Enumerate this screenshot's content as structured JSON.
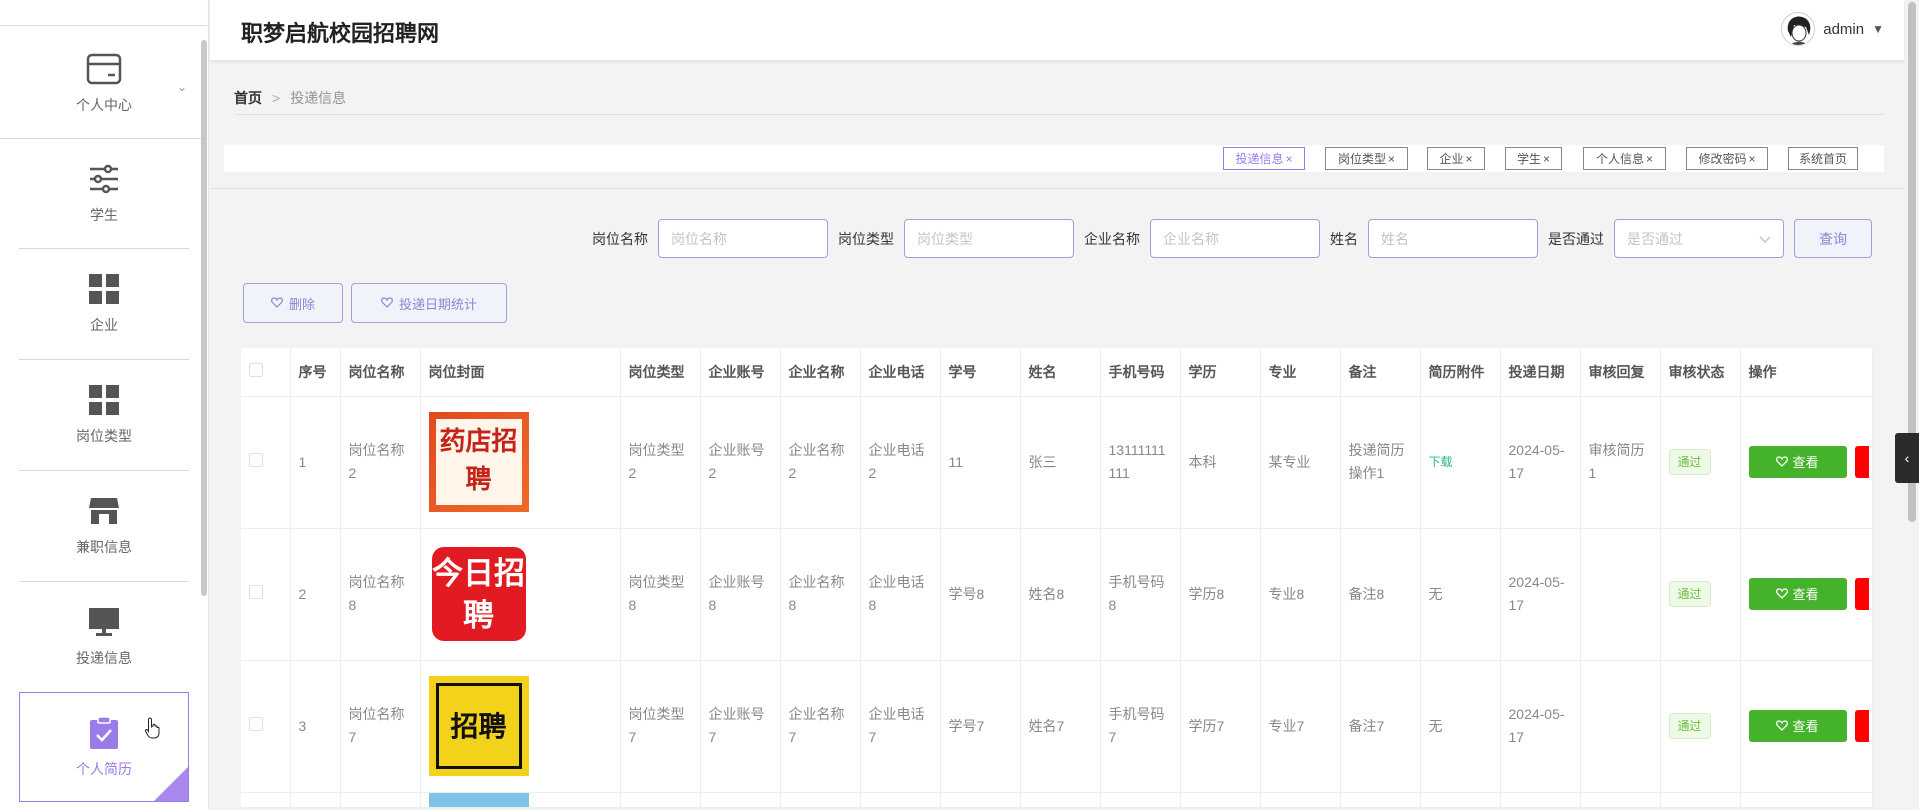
{
  "header": {
    "brand": "职梦启航校园招聘网",
    "username": "admin",
    "caret": "▼"
  },
  "sidebar": {
    "items": [
      {
        "label": "个人中心",
        "icon": "card-icon"
      },
      {
        "label": "学生",
        "icon": "sliders-icon"
      },
      {
        "label": "企业",
        "icon": "grid-icon"
      },
      {
        "label": "岗位类型",
        "icon": "grid-icon"
      },
      {
        "label": "兼职信息",
        "icon": "store-icon"
      },
      {
        "label": "投递信息",
        "icon": "monitor-icon"
      },
      {
        "label": "个人简历",
        "icon": "clipboard-check-icon"
      }
    ],
    "chevron": "⌄"
  },
  "breadcrumb": {
    "home": "首页",
    "sep": ">",
    "current": "投递信息"
  },
  "tags": [
    "投递信息",
    "岗位类型",
    "企业",
    "学生",
    "个人信息",
    "修改密码",
    "系统首页"
  ],
  "tag_close": "×",
  "search": {
    "fields": [
      {
        "label": "岗位名称",
        "placeholder": "岗位名称"
      },
      {
        "label": "岗位类型",
        "placeholder": "岗位类型"
      },
      {
        "label": "企业名称",
        "placeholder": "企业名称"
      },
      {
        "label": "姓名",
        "placeholder": "姓名"
      }
    ],
    "select_label": "是否通过",
    "select_placeholder": "是否通过",
    "query": "查询"
  },
  "actions": {
    "delete": "删除",
    "stats": "投递日期统计"
  },
  "table": {
    "headers": [
      "序号",
      "岗位名称",
      "岗位封面",
      "岗位类型",
      "企业账号",
      "企业名称",
      "企业电话",
      "学号",
      "姓名",
      "手机号码",
      "学历",
      "专业",
      "备注",
      "简历附件",
      "投递日期",
      "审核回复",
      "审核状态",
      "操作"
    ],
    "rows": [
      {
        "idx": "1",
        "name": "岗位名称2",
        "cover_text": "药店招聘",
        "type": "岗位类型2",
        "account": "企业账号2",
        "company": "企业名称2",
        "phone": "企业电话2",
        "student_no": "11",
        "person": "张三",
        "mobile": "13111111111",
        "edu": "本科",
        "major": "某专业",
        "note": "投递简历操作1",
        "attach": "下载",
        "date": "2024-05-17",
        "reply": "审核简历1",
        "status": "通过",
        "view": "查看"
      },
      {
        "idx": "2",
        "name": "岗位名称8",
        "cover_text": "今日招聘",
        "type": "岗位类型8",
        "account": "企业账号8",
        "company": "企业名称8",
        "phone": "企业电话8",
        "student_no": "学号8",
        "person": "姓名8",
        "mobile": "手机号码8",
        "edu": "学历8",
        "major": "专业8",
        "note": "备注8",
        "attach": "无",
        "date": "2024-05-17",
        "reply": "",
        "status": "通过",
        "view": "查看"
      },
      {
        "idx": "3",
        "name": "岗位名称7",
        "cover_text": "招聘",
        "type": "岗位类型7",
        "account": "企业账号7",
        "company": "企业名称7",
        "phone": "企业电话7",
        "student_no": "学号7",
        "person": "姓名7",
        "mobile": "手机号码7",
        "edu": "学历7",
        "major": "专业7",
        "note": "备注7",
        "attach": "无",
        "date": "2024-05-17",
        "reply": "",
        "status": "通过",
        "view": "查看"
      }
    ]
  },
  "colors": {
    "accent": "#9b7bea",
    "success": "#44b22a",
    "danger": "#ff0000"
  }
}
